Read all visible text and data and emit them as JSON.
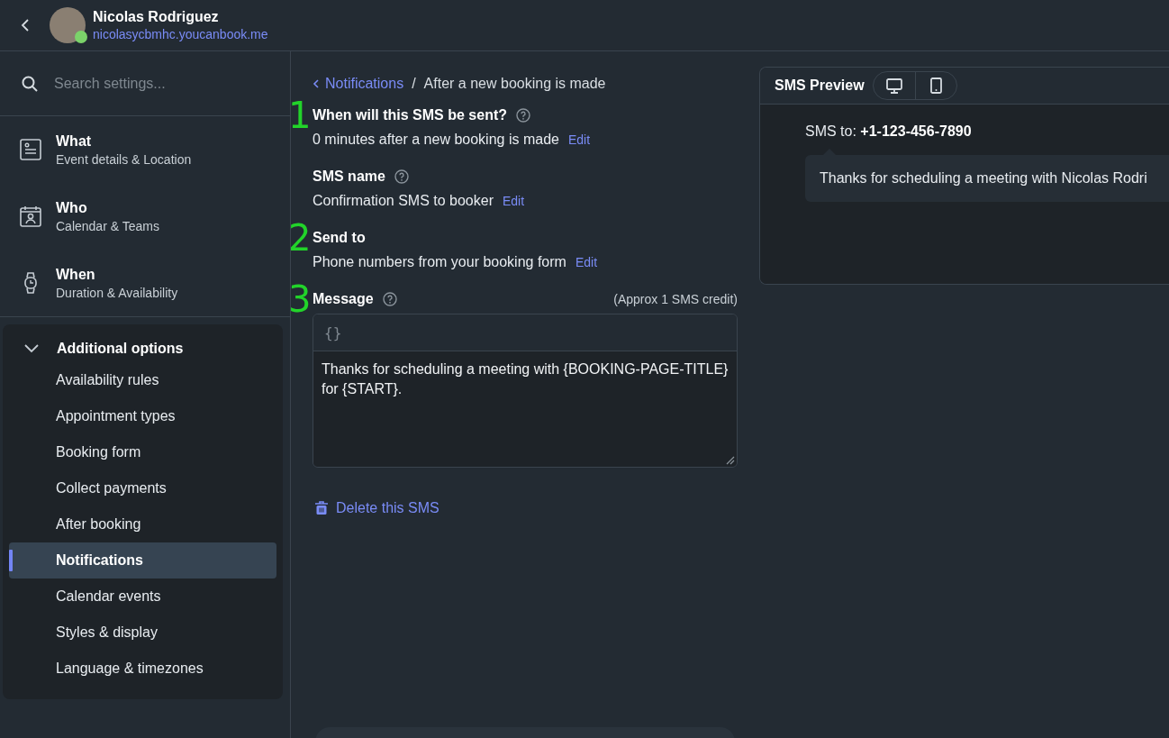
{
  "header": {
    "name": "Nicolas Rodriguez",
    "url": "nicolasycbmhc.youcanbook.me",
    "online": true
  },
  "sidebar": {
    "search": {
      "placeholder": "Search settings..."
    },
    "sections": [
      {
        "kind": "details",
        "title": "What",
        "subtitle": "Event details & Location"
      },
      {
        "kind": "calendar",
        "title": "Who",
        "subtitle": "Calendar & Teams"
      },
      {
        "kind": "watch",
        "title": "When",
        "subtitle": "Duration & Availability"
      }
    ],
    "group": {
      "title": "Additional options",
      "expanded": true,
      "items": [
        {
          "label": "Availability rules",
          "selected": false
        },
        {
          "label": "Appointment types",
          "selected": false
        },
        {
          "label": "Booking form",
          "selected": false
        },
        {
          "label": "Collect payments",
          "selected": false
        },
        {
          "label": "After booking",
          "selected": false
        },
        {
          "label": "Notifications",
          "selected": true
        },
        {
          "label": "Calendar events",
          "selected": false
        },
        {
          "label": "Styles & display",
          "selected": false
        },
        {
          "label": "Language & timezones",
          "selected": false
        }
      ]
    }
  },
  "breadcrumb": {
    "parent": "Notifications",
    "separator": "/",
    "current": "After a new booking is made"
  },
  "fields": [
    {
      "annotation": "1",
      "label": "When will this SMS be sent?",
      "help": true,
      "value": "0 minutes after a new booking is made",
      "action": "Edit"
    },
    {
      "label": "SMS name",
      "help": true,
      "value": "Confirmation SMS to booker",
      "action": "Edit"
    },
    {
      "annotation": "2",
      "label": "Send to",
      "help": false,
      "value": "Phone numbers from your booking form",
      "action": "Edit"
    }
  ],
  "message": {
    "annotation": "3",
    "label": "Message",
    "help": true,
    "note": "(Approx 1 SMS credit)",
    "toolbar": "{}",
    "value": "Thanks for scheduling a meeting with {BOOKING-PAGE-TITLE} for {START}."
  },
  "delete_action": "Delete this SMS",
  "preview": {
    "title": "SMS Preview",
    "devices": [
      {
        "kind": "desktop"
      },
      {
        "kind": "mobile"
      }
    ],
    "to_label": "SMS to:",
    "to_number": "+1-123-456-7890",
    "bubble": "Thanks for scheduling a meeting with Nicolas Rodri"
  }
}
